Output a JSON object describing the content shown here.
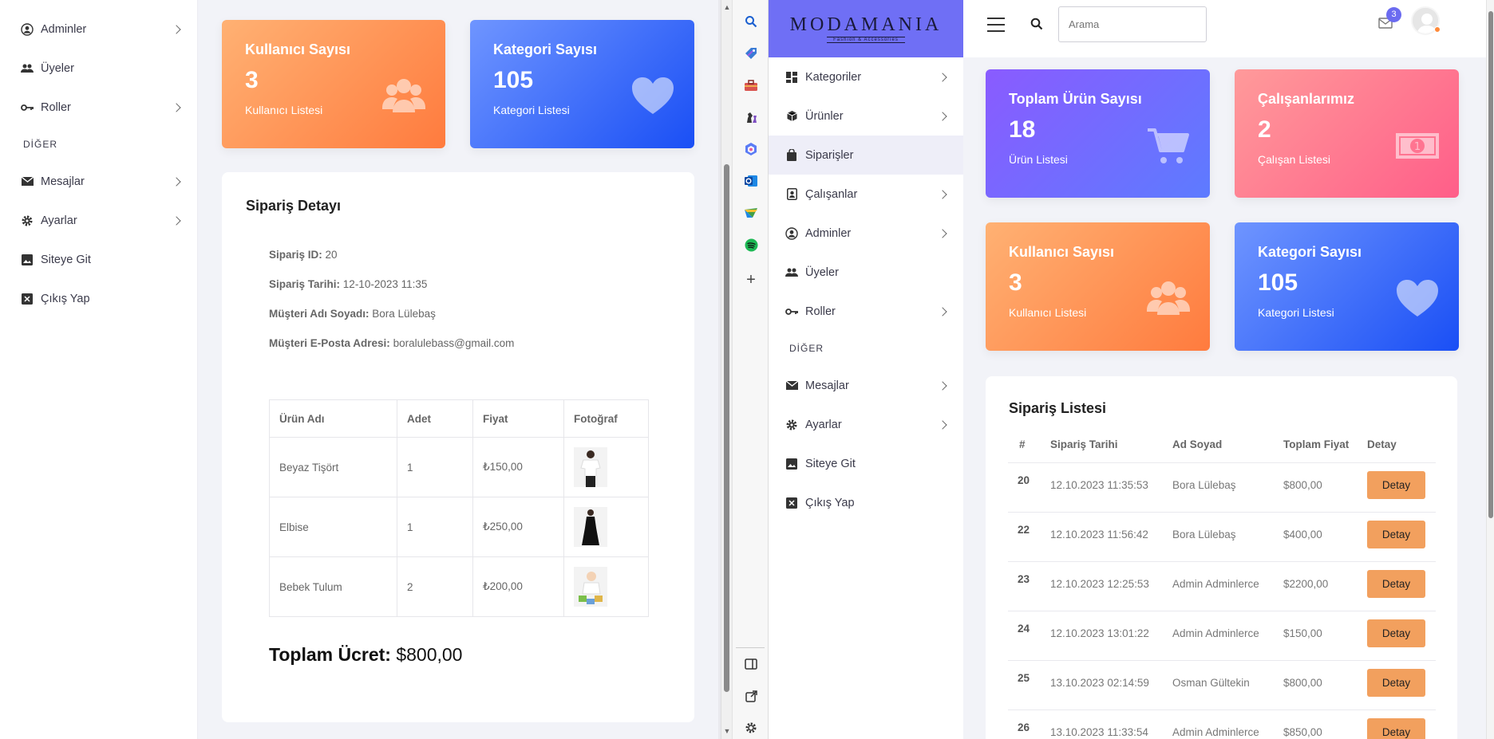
{
  "left_sidebar": {
    "items": [
      {
        "label": "Adminler",
        "icon": "user-circle-icon",
        "chevron": true
      },
      {
        "label": "Üyeler",
        "icon": "users-icon",
        "chevron": false
      },
      {
        "label": "Roller",
        "icon": "key-icon",
        "chevron": true
      }
    ],
    "section": "DİĞER",
    "items2": [
      {
        "label": "Mesajlar",
        "icon": "envelope-icon",
        "chevron": true
      },
      {
        "label": "Ayarlar",
        "icon": "gear-icon",
        "chevron": true
      },
      {
        "label": "Siteye Git",
        "icon": "image-icon",
        "chevron": false
      },
      {
        "label": "Çıkış Yap",
        "icon": "close-box-icon",
        "chevron": false
      }
    ]
  },
  "left_cards": [
    {
      "title": "Kullanıcı Sayısı",
      "value": "3",
      "sub": "Kullanıcı Listesi",
      "icon": "users-icon",
      "color": "#ff8a4c"
    },
    {
      "title": "Kategori Sayısı",
      "value": "105",
      "sub": "Kategori Listesi",
      "icon": "heart-icon",
      "color": "#3b6cff"
    }
  ],
  "order_detail": {
    "title": "Sipariş Detayı",
    "id_label": "Sipariş ID:",
    "id_value": "20",
    "date_label": "Sipariş Tarihi:",
    "date_value": "12-10-2023 11:35",
    "name_label": "Müşteri Adı Soyadı:",
    "name_value": "Bora Lülebaş",
    "email_label": "Müşteri E-Posta Adresi:",
    "email_value": "boralulebass@gmail.com",
    "columns": [
      "Ürün Adı",
      "Adet",
      "Fiyat",
      "Fotoğraf"
    ],
    "rows": [
      {
        "name": "Beyaz Tişört",
        "qty": "1",
        "price": "₺150,00"
      },
      {
        "name": "Elbise",
        "qty": "1",
        "price": "₺250,00"
      },
      {
        "name": "Bebek Tulum",
        "qty": "2",
        "price": "₺200,00"
      }
    ],
    "total_label": "Toplam Ücret:",
    "total_value": "$800,00"
  },
  "edge_strip": {
    "icons": [
      "search-icon",
      "tag-icon",
      "toolbox-icon",
      "chess-icon",
      "copilot-icon",
      "outlook-icon",
      "drive-icon",
      "spotify-icon",
      "plus-icon",
      "split-view-icon",
      "external-link-icon",
      "gear-icon"
    ]
  },
  "right_sidebar": {
    "brand": "MODAMANIA",
    "brand_sub": "Fashion & Accessories",
    "items": [
      {
        "label": "Kategoriler",
        "icon": "grid-icon",
        "chevron": true
      },
      {
        "label": "Ürünler",
        "icon": "box-icon",
        "chevron": true
      },
      {
        "label": "Siparişler",
        "icon": "bag-icon",
        "chevron": false
      },
      {
        "label": "Çalışanlar",
        "icon": "badge-icon",
        "chevron": true
      },
      {
        "label": "Adminler",
        "icon": "user-circle-icon",
        "chevron": true
      },
      {
        "label": "Üyeler",
        "icon": "users-icon",
        "chevron": false
      },
      {
        "label": "Roller",
        "icon": "key-icon",
        "chevron": true
      }
    ],
    "section": "DİĞER",
    "items2": [
      {
        "label": "Mesajlar",
        "icon": "envelope-icon",
        "chevron": true
      },
      {
        "label": "Ayarlar",
        "icon": "gear-icon",
        "chevron": true
      },
      {
        "label": "Siteye Git",
        "icon": "image-icon",
        "chevron": false
      },
      {
        "label": "Çıkış Yap",
        "icon": "close-box-icon",
        "chevron": false
      }
    ]
  },
  "topbar": {
    "search_placeholder": "Arama",
    "mail_badge": "3"
  },
  "right_cards": [
    {
      "title": "Toplam Ürün Sayısı",
      "value": "18",
      "sub": "Ürün Listesi",
      "icon": "cart-icon",
      "color": "#7a66ff"
    },
    {
      "title": "Çalışanlarımız",
      "value": "2",
      "sub": "Çalışan Listesi",
      "icon": "money-icon",
      "color": "#ff7a95"
    },
    {
      "title": "Kullanıcı Sayısı",
      "value": "3",
      "sub": "Kullanıcı Listesi",
      "icon": "users-icon",
      "color": "#ff8a4c"
    },
    {
      "title": "Kategori Sayısı",
      "value": "105",
      "sub": "Kategori Listesi",
      "icon": "heart-icon",
      "color": "#3b6cff"
    }
  ],
  "order_list": {
    "title": "Sipariş Listesi",
    "columns": [
      "#",
      "Sipariş Tarihi",
      "Ad Soyad",
      "Toplam Fiyat",
      "Detay"
    ],
    "button_label": "Detay",
    "rows": [
      {
        "id": "20",
        "date": "12.10.2023 11:35:53",
        "name": "Bora Lülebaş",
        "price": "$800,00"
      },
      {
        "id": "22",
        "date": "12.10.2023 11:56:42",
        "name": "Bora Lülebaş",
        "price": "$400,00"
      },
      {
        "id": "23",
        "date": "12.10.2023 12:25:53",
        "name": "Admin Adminlerce",
        "price": "$2200,00"
      },
      {
        "id": "24",
        "date": "12.10.2023 13:01:22",
        "name": "Admin Adminlerce",
        "price": "$150,00"
      },
      {
        "id": "25",
        "date": "13.10.2023 02:14:59",
        "name": "Osman Gültekin",
        "price": "$800,00"
      },
      {
        "id": "26",
        "date": "13.10.2023 11:33:54",
        "name": "Admin Adminlerce",
        "price": "$850,00"
      }
    ]
  }
}
